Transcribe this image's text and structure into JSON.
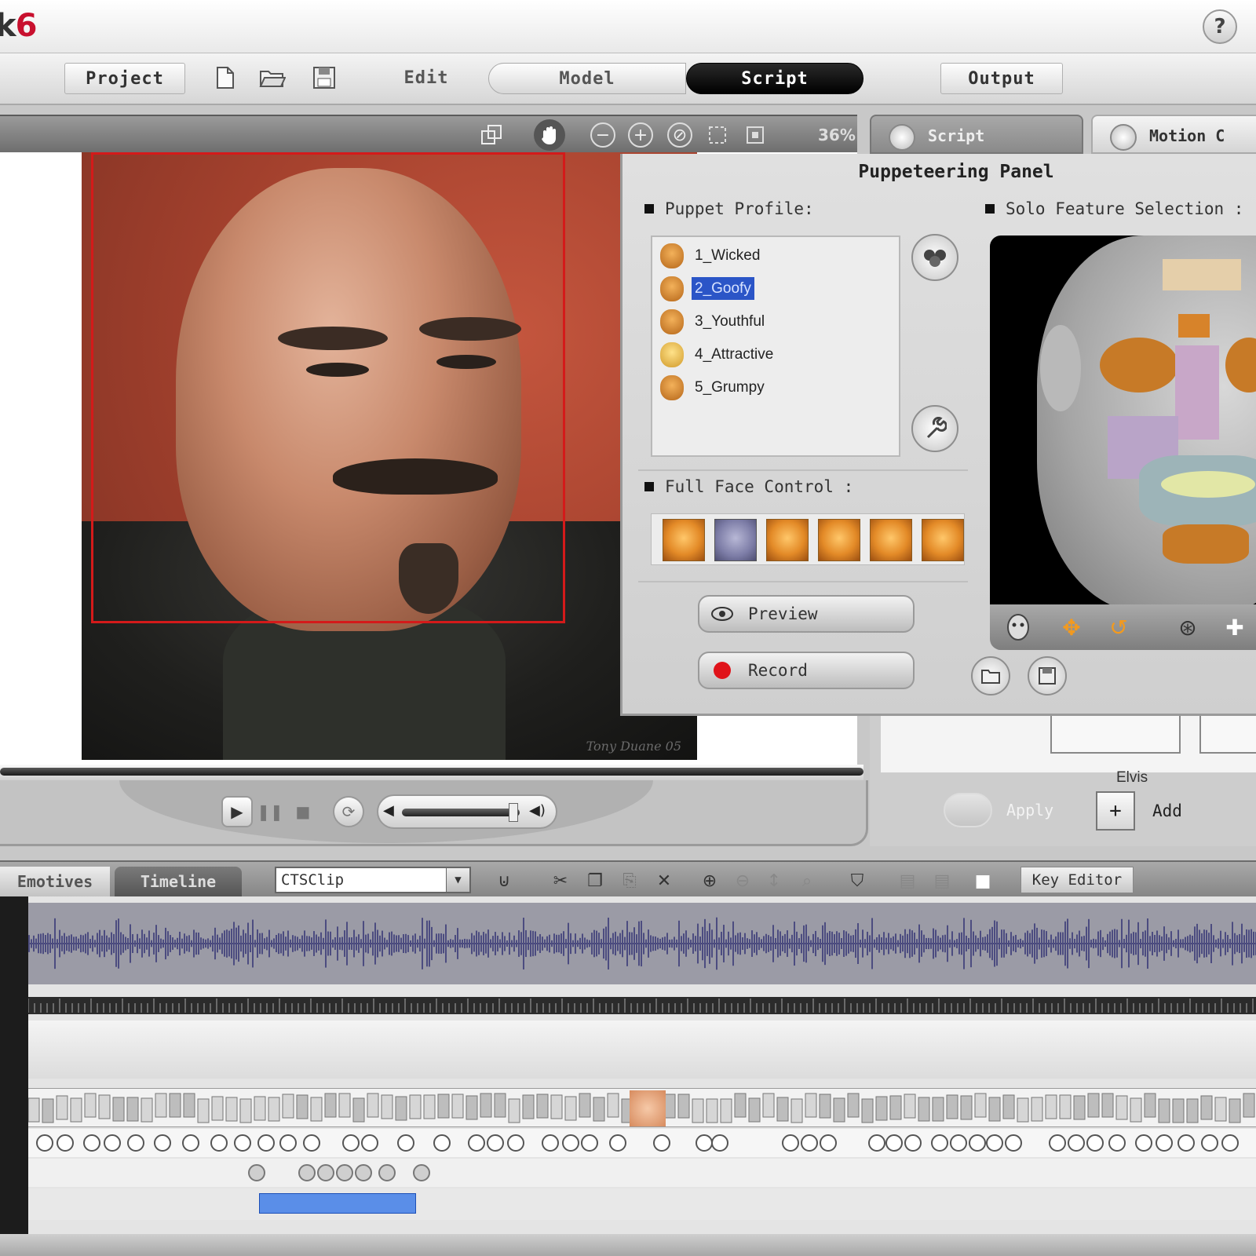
{
  "app": {
    "name_prefix": "k",
    "name_suffix": "6",
    "help_label": "?"
  },
  "menu": {
    "project": "Project",
    "edit": "Edit",
    "model": "Model",
    "script": "Script",
    "output": "Output"
  },
  "viewer": {
    "zoom": "36%",
    "watermark": "Tony Duane 05"
  },
  "panel_tabs": {
    "script": "Script",
    "motion": "Motion C"
  },
  "panel": {
    "title": "Puppeteering Panel",
    "puppet_profile_label": "Puppet Profile:",
    "solo_feature_label": "Solo Feature Selection :",
    "full_face_label": "Full Face Control :",
    "profiles": [
      "1_Wicked",
      "2_Goofy",
      "3_Youthful",
      "4_Attractive",
      "5_Grumpy"
    ],
    "selected_profile": "2_Goofy",
    "preview_label": "Preview",
    "record_label": "Record"
  },
  "right_lower": {
    "elvis": "Elvis",
    "apply": "Apply",
    "add": "Add"
  },
  "timeline": {
    "emotives_tab": "Emotives",
    "timeline_tab": "Timeline",
    "clip_value": "CTSClip",
    "key_editor": "Key Editor"
  },
  "colors": {
    "record": "#e0131a",
    "selection": "#2b55c7",
    "face_frame": "#d41a1a"
  }
}
